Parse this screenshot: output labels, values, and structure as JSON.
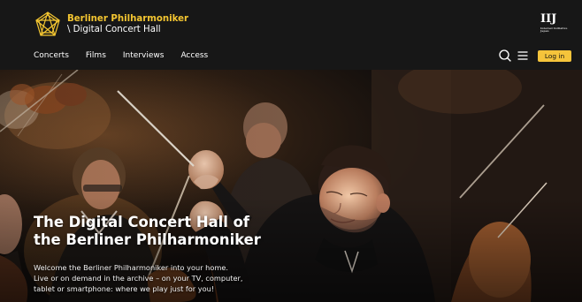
{
  "header": {
    "logo_line1": "Berliner Philharmoniker",
    "logo_line2": "\\ Digital Concert Hall",
    "partner_mark": "IIJ",
    "partner_caption": "Internet Initiative Japan"
  },
  "nav": {
    "items": [
      "Concerts",
      "Films",
      "Interviews",
      "Access"
    ]
  },
  "actions": {
    "search_icon": "search-icon",
    "menu_icon": "hamburger-menu-icon",
    "login_label": "Log in"
  },
  "hero": {
    "title_line1": "The Digital Concert Hall of",
    "title_line2": "the Berliner Philharmoniker",
    "desc_line1": "Welcome the Berliner Philharmoniker into your home.",
    "desc_line2": "Live or on demand in the archive – on your TV, computer,",
    "desc_line3": "tablet or smartphone: where we play just for you!"
  },
  "colors": {
    "brand_yellow": "#f5c43b",
    "header_bg": "#171717"
  }
}
